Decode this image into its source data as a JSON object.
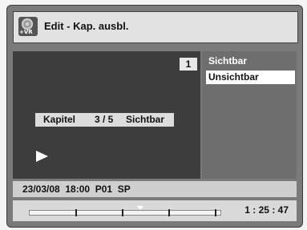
{
  "header": {
    "title": "Edit - Kap. ausbl.",
    "icon": "disc-vr-icon",
    "icon_text": "+VR"
  },
  "video": {
    "chapter_indicator": "1",
    "chapter_bar": {
      "label": "Kapitel",
      "position": "3 / 5",
      "status": "Sichtbar"
    },
    "play_icon": "play-icon"
  },
  "menu": {
    "items": [
      "Sichtbar",
      "Unsichtbar"
    ],
    "selected_index": 1
  },
  "info": {
    "status_line": "23/03/08  18:00  P01  SP"
  },
  "timeline": {
    "time": "1 : 25 : 47",
    "chapter_count": 5,
    "current_chapter": 3
  },
  "colors": {
    "screen_bg": "#7a7a7a",
    "video_bg": "#3d3d3d",
    "selected_bg": "#ffffff"
  }
}
